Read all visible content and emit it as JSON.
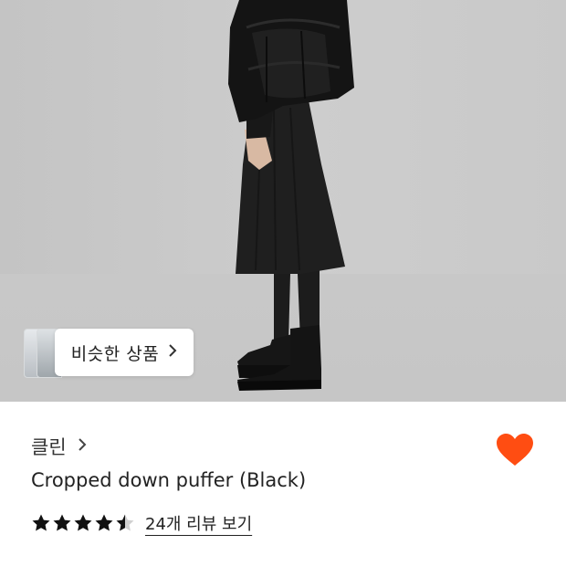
{
  "hero": {
    "similar_products_label": "비슷한 상품",
    "chevron_icon": "chevron-right-icon"
  },
  "product": {
    "brand": "클린",
    "brand_chevron_icon": "chevron-right-icon",
    "name": "Cropped down puffer (Black)",
    "rating": 4.5,
    "max_rating": 5,
    "review_link_label": "24개 리뷰 보기",
    "wishlist_icon": "heart-icon"
  },
  "colors": {
    "heart": "#ff4d12",
    "star": "#111111",
    "star_empty": "#d0d0d0"
  }
}
